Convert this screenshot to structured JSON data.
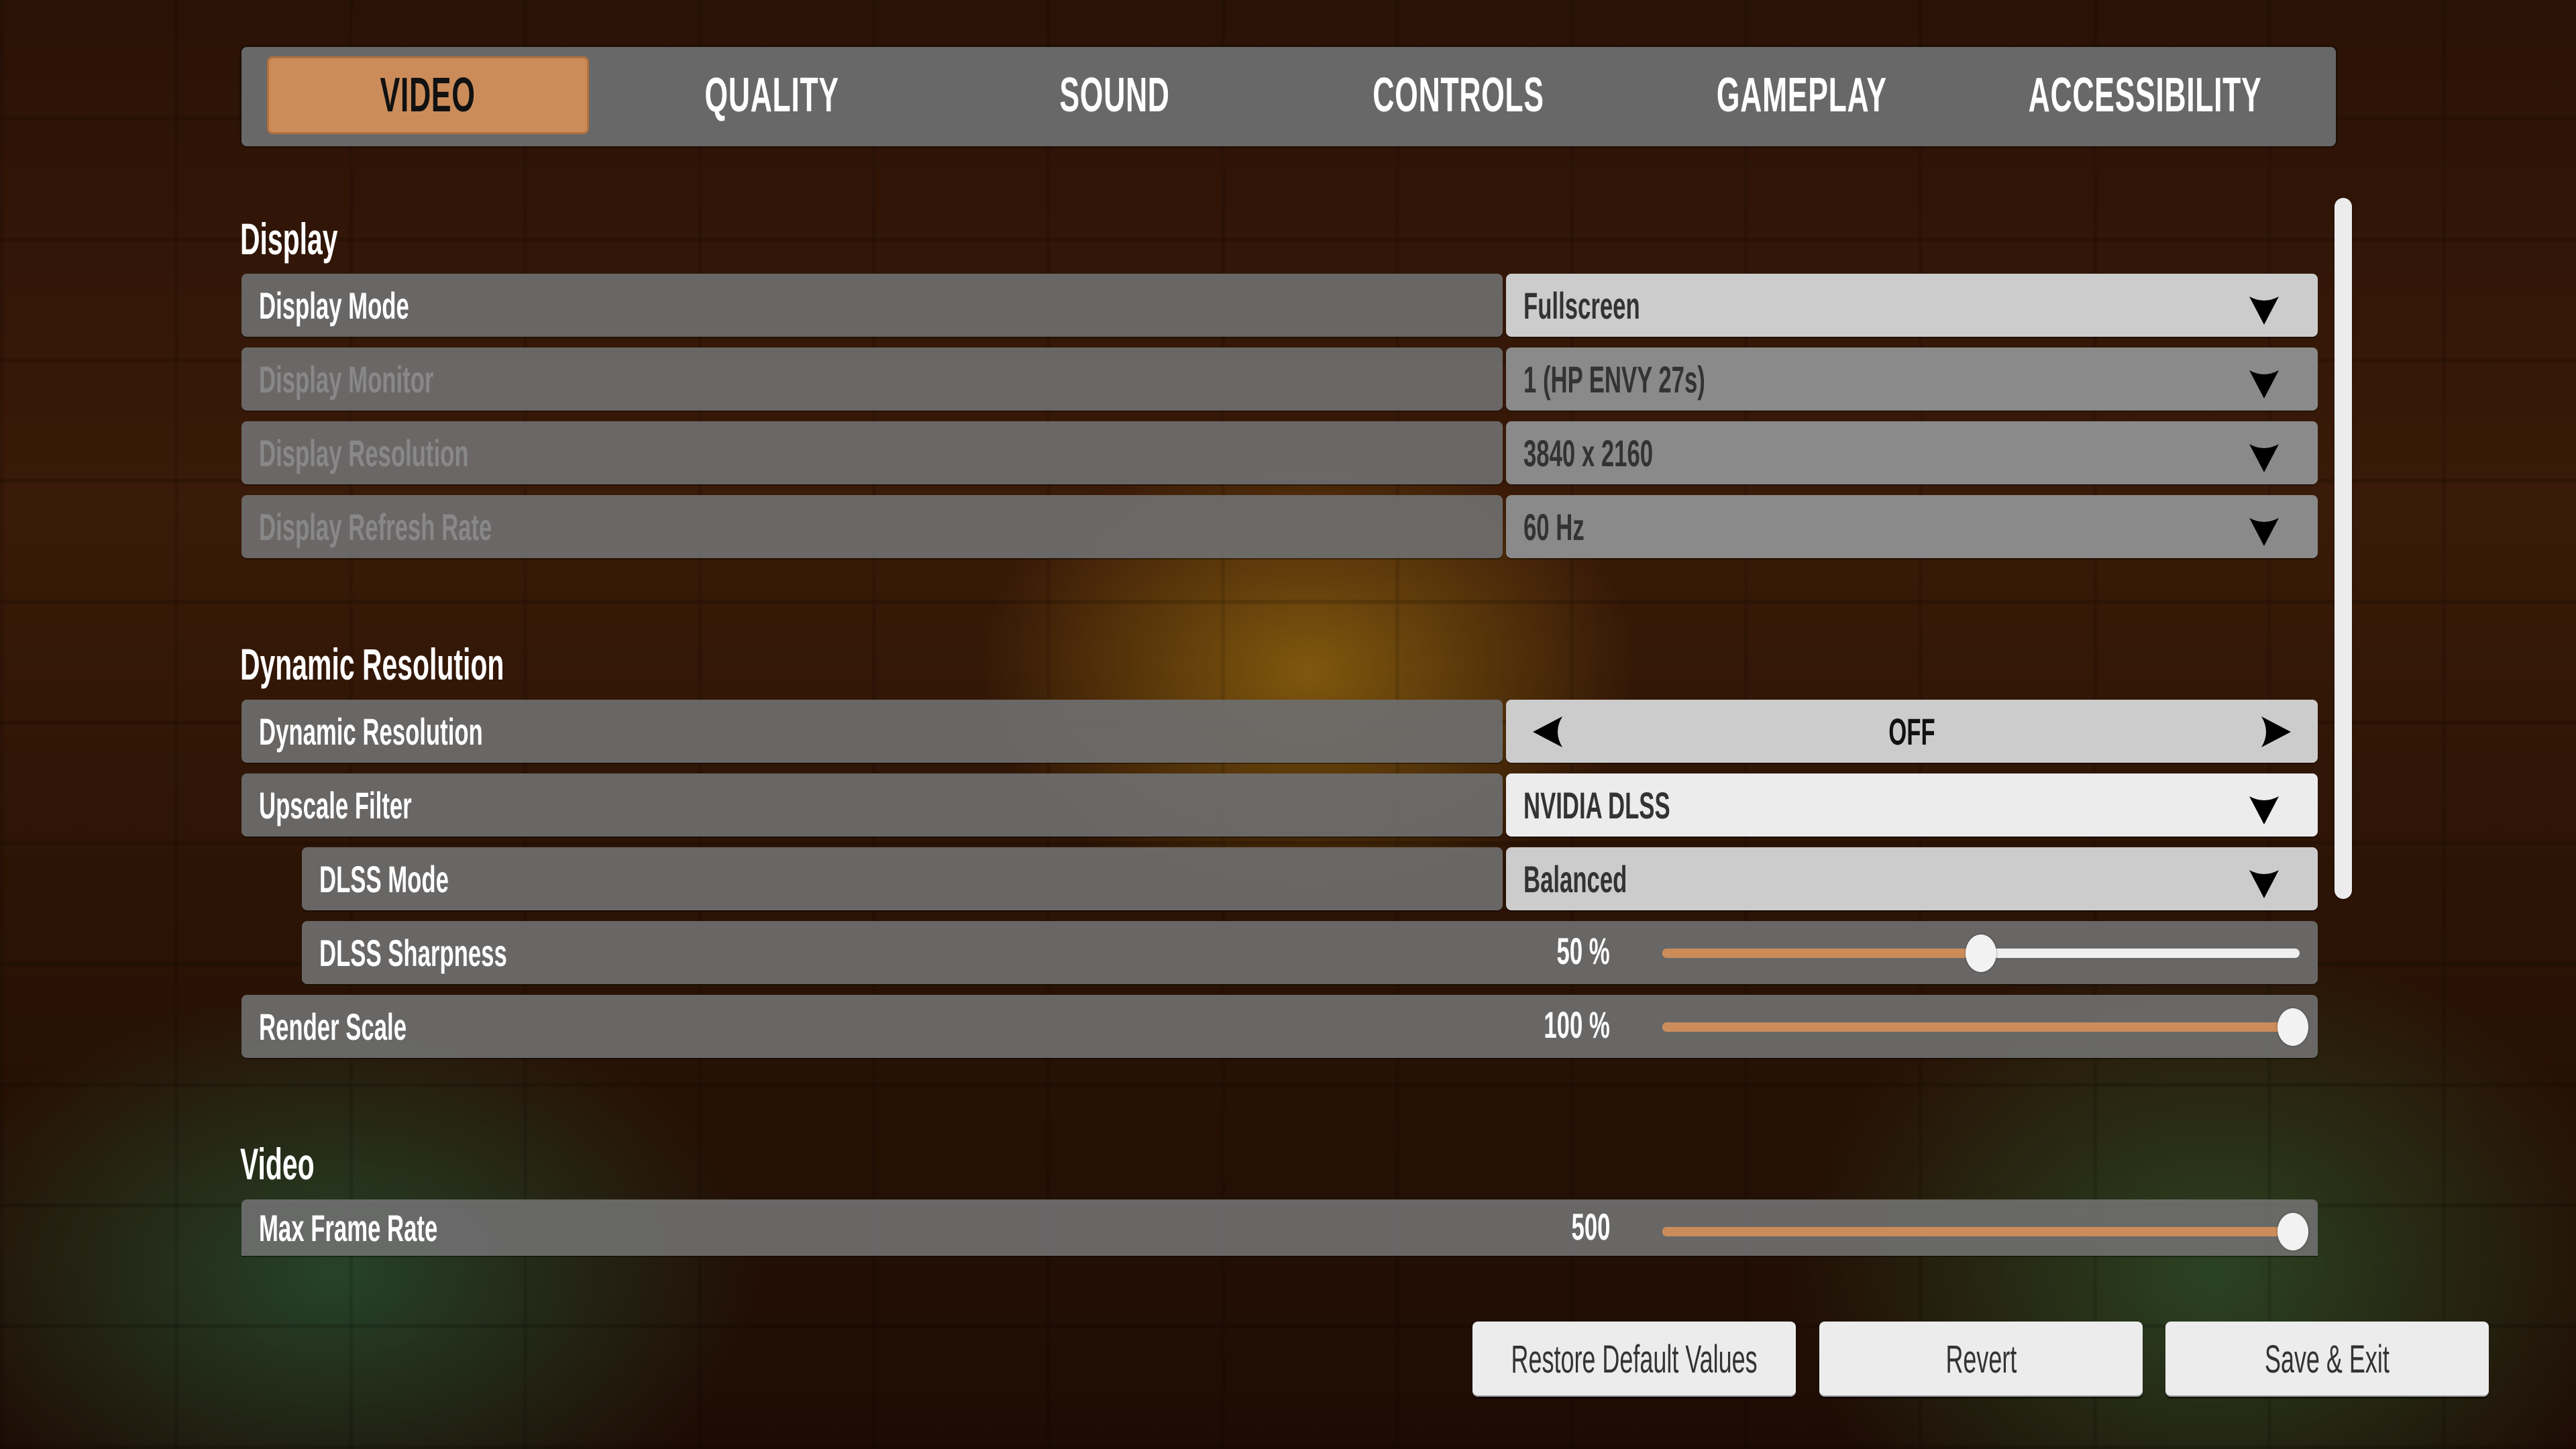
{
  "tabs": [
    {
      "label": "VIDEO",
      "active": true
    },
    {
      "label": "QUALITY",
      "active": false
    },
    {
      "label": "SOUND",
      "active": false
    },
    {
      "label": "CONTROLS",
      "active": false
    },
    {
      "label": "GAMEPLAY",
      "active": false
    },
    {
      "label": "ACCESSIBILITY",
      "active": false
    }
  ],
  "colors": {
    "accent": "#cb8c5a",
    "panel": "#6e6e6e",
    "dropdown_bg": "#cccccc",
    "dropdown_highlight": "#ececec",
    "disabled_text": "#888888"
  },
  "sections": {
    "display": {
      "title": "Display",
      "rows": {
        "display_mode": {
          "label": "Display Mode",
          "value": "Fullscreen",
          "type": "dropdown",
          "enabled": true
        },
        "display_monitor": {
          "label": "Display Monitor",
          "value": "1 (HP ENVY 27s)",
          "type": "dropdown",
          "enabled": false
        },
        "display_resolution": {
          "label": "Display Resolution",
          "value": "3840 x 2160",
          "type": "dropdown",
          "enabled": false
        },
        "display_refresh_rate": {
          "label": "Display Refresh Rate",
          "value": "60 Hz",
          "type": "dropdown",
          "enabled": false
        }
      }
    },
    "dynamic_resolution": {
      "title": "Dynamic Resolution",
      "rows": {
        "dynamic_resolution": {
          "label": "Dynamic Resolution",
          "value": "OFF",
          "type": "stepper"
        },
        "upscale_filter": {
          "label": "Upscale Filter",
          "value": "NVIDIA DLSS",
          "type": "dropdown",
          "highlighted": true
        },
        "dlss_mode": {
          "label": "DLSS Mode",
          "value": "Balanced",
          "type": "dropdown"
        },
        "dlss_sharpness": {
          "label": "DLSS Sharpness",
          "value_text": "50 %",
          "type": "slider",
          "fraction": 0.5
        },
        "render_scale": {
          "label": "Render Scale",
          "value_text": "100 %",
          "type": "slider",
          "fraction": 1.0
        }
      }
    },
    "video": {
      "title": "Video",
      "rows": {
        "max_frame_rate": {
          "label": "Max Frame Rate",
          "value_text": "500",
          "type": "slider",
          "fraction": 1.0
        }
      }
    }
  },
  "scrollbar": {
    "position_fraction": 0.0
  },
  "footer": {
    "restore_label": "Restore Default Values",
    "revert_label": "Revert",
    "save_label": "Save & Exit"
  }
}
